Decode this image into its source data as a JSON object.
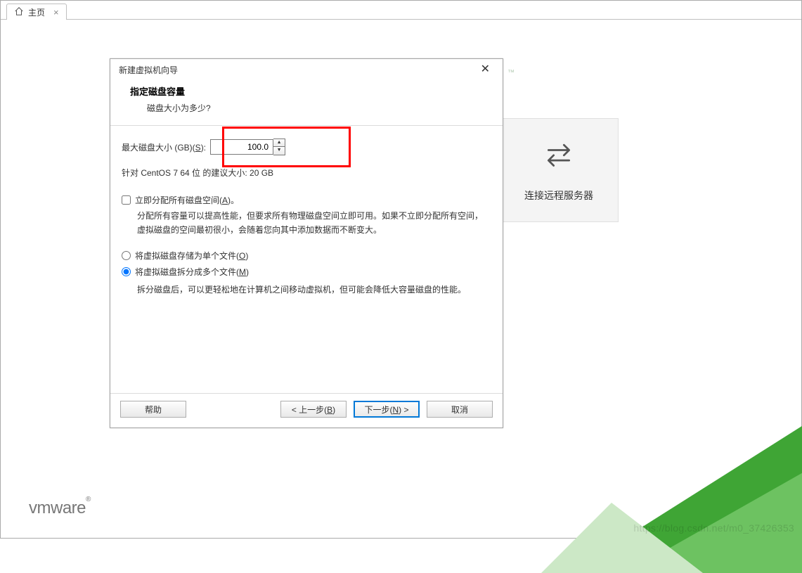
{
  "tab": {
    "label": "主页"
  },
  "bgcard": {
    "label": "连接远程服务器"
  },
  "logo": {
    "text": "vmware"
  },
  "watermark": "https://blog.csdn.net/m0_37426353",
  "dialog": {
    "title": "新建虚拟机向导",
    "header": {
      "title": "指定磁盘容量",
      "subtitle": "磁盘大小为多少?"
    },
    "disk_size": {
      "label_prefix": "最大磁盘大小 (GB)(",
      "label_acc": "S",
      "label_suffix": "):",
      "value": "100.0"
    },
    "recommend": "针对 CentOS 7 64 位 的建议大小: 20 GB",
    "allocate": {
      "label_prefix": "立即分配所有磁盘空间(",
      "label_acc": "A",
      "label_suffix": ")。",
      "desc": "分配所有容量可以提高性能，但要求所有物理磁盘空间立即可用。如果不立即分配所有空间，虚拟磁盘的空间最初很小，会随着您向其中添加数据而不断变大。"
    },
    "radio_single": {
      "label_prefix": "将虚拟磁盘存储为单个文件(",
      "label_acc": "O",
      "label_suffix": ")"
    },
    "radio_split": {
      "label_prefix": "将虚拟磁盘拆分成多个文件(",
      "label_acc": "M",
      "label_suffix": ")",
      "desc": "拆分磁盘后，可以更轻松地在计算机之间移动虚拟机，但可能会降低大容量磁盘的性能。"
    },
    "buttons": {
      "help": "帮助",
      "back_prefix": "< 上一步(",
      "back_acc": "B",
      "back_suffix": ")",
      "next_prefix": "下一步(",
      "next_acc": "N",
      "next_suffix": ") >",
      "cancel": "取消"
    }
  },
  "tm": "™"
}
